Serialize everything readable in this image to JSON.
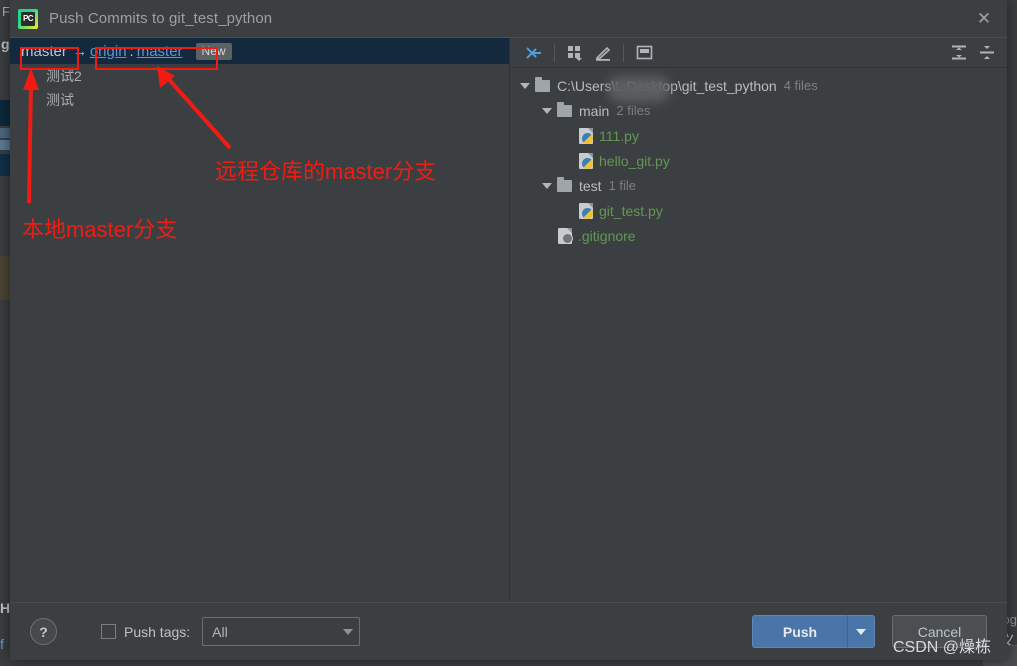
{
  "background_ide": {
    "menu_char": "F",
    "project_char": "git",
    "bottom_left_char": "H",
    "bottom_left_char2": "f",
    "right_char": "og",
    "right_char2": "义"
  },
  "dialog": {
    "icon_name": "pycharm-icon",
    "icon_text": "PC",
    "title": "Push Commits to git_test_python",
    "close_label": "✕"
  },
  "commits_pane": {
    "branch_row": {
      "local_branch": "master",
      "arrow": "→",
      "remote_name": "origin",
      "separator": ":",
      "remote_branch": "master",
      "new_badge": "New"
    },
    "commits": [
      {
        "message": "测试2"
      },
      {
        "message": "测试"
      }
    ]
  },
  "files_pane": {
    "toolbar": [
      {
        "name": "collapse-selection-icon",
        "label": ""
      },
      {
        "name": "group-by-icon",
        "label": ""
      },
      {
        "name": "edit-icon",
        "label": ""
      },
      {
        "name": "preview-panel-icon",
        "label": ""
      },
      {
        "name": "expand-all-icon",
        "label": ""
      },
      {
        "name": "collapse-all-icon",
        "label": ""
      }
    ],
    "tree": [
      {
        "indent": 0,
        "expander": "expanded",
        "icon": "folder-icon",
        "label": "C:\\Users\\L            Desktop\\git_test_python",
        "count": "4 files",
        "green": false
      },
      {
        "indent": 1,
        "expander": "expanded",
        "icon": "folder-icon",
        "label": "main",
        "count": "2 files",
        "green": false
      },
      {
        "indent": 2,
        "expander": "none",
        "icon": "python-file-icon",
        "label": "111.py",
        "count": "",
        "green": true
      },
      {
        "indent": 2,
        "expander": "none",
        "icon": "python-file-icon",
        "label": "hello_git.py",
        "count": "",
        "green": true
      },
      {
        "indent": 1,
        "expander": "expanded",
        "icon": "folder-icon",
        "label": "test",
        "count": "1 file",
        "green": false
      },
      {
        "indent": 2,
        "expander": "none",
        "icon": "python-file-icon",
        "label": "git_test.py",
        "count": "",
        "green": true
      },
      {
        "indent": 1,
        "expander": "none",
        "icon": "gitignore-file-icon",
        "label": ".gitignore",
        "count": "",
        "green": true
      }
    ]
  },
  "bottom_bar": {
    "help_label": "?",
    "push_tags_checked": false,
    "push_tags_label": "Push tags:",
    "tags_value": "All",
    "push_label": "Push",
    "cancel_label": "Cancel"
  },
  "annotations": [
    {
      "text": "远程仓库的master分支"
    },
    {
      "text": "本地master分支"
    }
  ],
  "watermark": {
    "text": "CSDN @燥栋"
  },
  "colors": {
    "dialog_bg": "#3c3f41",
    "selected_row": "#14293d",
    "link": "#5f93d8",
    "file_green": "#629755",
    "push_blue": "#4a75a8",
    "annotation_red": "#f01c14"
  }
}
